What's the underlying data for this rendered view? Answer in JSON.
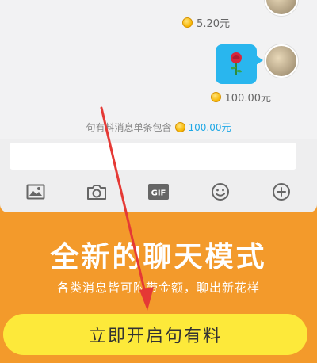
{
  "chat": {
    "messages": [
      {
        "amount": "5.20元"
      },
      {
        "emoji_icon": "rose-icon",
        "amount": "100.00元"
      }
    ],
    "notice_prefix": "句有料消息单条包含",
    "notice_amount": "100.00元",
    "input_placeholder": ""
  },
  "toolbar": {
    "items": [
      {
        "name": "image-icon"
      },
      {
        "name": "camera-icon"
      },
      {
        "name": "gif-icon",
        "label": "GIF"
      },
      {
        "name": "emoji-icon"
      },
      {
        "name": "plus-icon"
      }
    ]
  },
  "promo": {
    "title": "全新的聊天模式",
    "subtitle": "各类消息皆可附带金额，聊出新花样",
    "cta_label": "立即开启句有料"
  },
  "colors": {
    "background": "#f39a2b",
    "bubble": "#29b6ee",
    "highlight": "#1ea8e6",
    "cta": "#fde93a",
    "coin": "#f7b500",
    "arrow": "#e53935"
  }
}
